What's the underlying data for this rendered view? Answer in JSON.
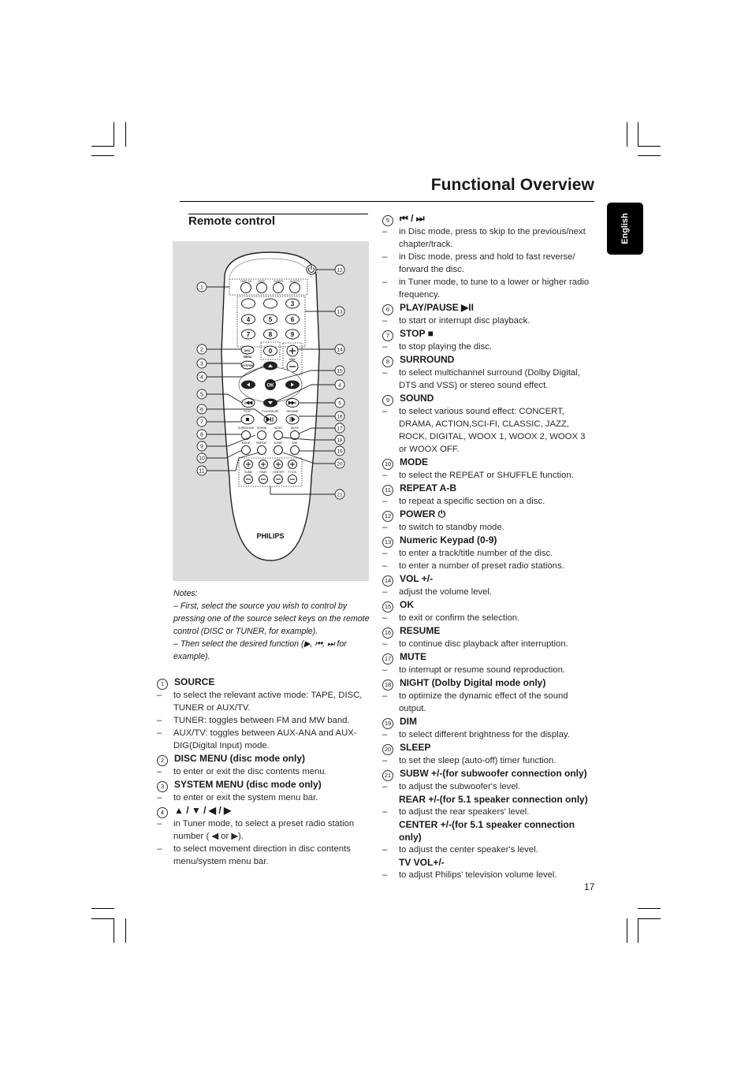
{
  "page": {
    "title": "Functional Overview",
    "section_title": "Remote control",
    "language_tab": "English",
    "page_number": "17"
  },
  "figure": {
    "remote_logo": "PHILIPS",
    "source_keys": [
      "TAPE 1/2",
      "DISC",
      "TUNER",
      "AUX/TV"
    ],
    "keypad": [
      "",
      "",
      "3",
      "4",
      "5",
      "6",
      "7",
      "8",
      "9",
      "0"
    ],
    "vol_label": "VOL",
    "disc_label": "DISC",
    "menu_label": "MENU",
    "system_label": "SYSTEM",
    "ok_label": "OK",
    "labels": {
      "stop": "STOP",
      "play_pause": "PLAY/PAUSE",
      "resume": "RESUME",
      "surround": "SURROUND",
      "sound": "SOUND",
      "night": "NIGHT",
      "mute": "MUTE",
      "mode": "MODE",
      "repeat": "REPEAT",
      "sleep": "SLEEP",
      "dim": "DIM",
      "subw": "SUBW",
      "rear": "REAR",
      "center": "CENTER",
      "tv_vol": "TV VOL"
    },
    "callouts_left": [
      "1",
      "2",
      "3",
      "4",
      "5",
      "6",
      "7",
      "8",
      "9",
      "10",
      "11"
    ],
    "callouts_right": [
      "12",
      "13",
      "14",
      "15",
      "4",
      "5",
      "16",
      "17",
      "18",
      "19",
      "20",
      "21"
    ]
  },
  "notes": {
    "heading": "Notes:",
    "lines": [
      "–  First, select the source you wish to control by pressing one of the source select keys on the remote control (DISC or TUNER, for example).",
      "–  Then select the desired function (▶, ⏮, ⏭ for example)."
    ]
  },
  "left_items": [
    {
      "num": "1",
      "title": "SOURCE",
      "desc": [
        "to select the relevant active mode: TAPE, DISC, TUNER or AUX/TV.",
        "TUNER: toggles between FM and MW band.",
        "AUX/TV: toggles between AUX-ANA and AUX-DIG(Digital Input) mode."
      ]
    },
    {
      "num": "2",
      "title": "DISC MENU (disc mode only)",
      "desc": [
        "to enter or exit the disc contents menu."
      ]
    },
    {
      "num": "3",
      "title": "SYSTEM MENU (disc mode only)",
      "desc": [
        "to enter or exit the system menu bar."
      ]
    },
    {
      "num": "4",
      "title": "▲ / ▼ / ◀ / ▶",
      "desc": [
        "in Tuner mode, to select a preset radio station number ( ◀ or ▶).",
        "to select movement direction in disc contents menu/system menu bar."
      ]
    }
  ],
  "right_items": [
    {
      "num": "5",
      "title": "⏮ / ⏭",
      "desc": [
        "in Disc mode, press to skip to the previous/next chapter/track.",
        "in Disc mode, press and hold to fast reverse/ forward the disc.",
        "in Tuner mode, to tune to a lower or higher radio frequency."
      ]
    },
    {
      "num": "6",
      "title": "PLAY/PAUSE ▶II",
      "desc": [
        "to start or interrupt disc playback."
      ]
    },
    {
      "num": "7",
      "title": "STOP ■",
      "desc": [
        "to stop playing the disc."
      ]
    },
    {
      "num": "8",
      "title": "SURROUND",
      "desc": [
        "to select multichannel surround (Dolby Digital, DTS and VSS) or stereo sound effect."
      ]
    },
    {
      "num": "9",
      "title": "SOUND",
      "desc": [
        "to select various sound effect: CONCERT, DRAMA, ACTION,SCI-FI, CLASSIC, JAZZ, ROCK, DIGITAL, WOOX 1, WOOX 2, WOOX 3 or WOOX OFF."
      ]
    },
    {
      "num": "10",
      "title": "MODE",
      "desc": [
        "to select the REPEAT or SHUFFLE function."
      ]
    },
    {
      "num": "11",
      "title": "REPEAT A-B",
      "desc": [
        "to repeat a specific section on a disc."
      ]
    },
    {
      "num": "12",
      "title": "POWER ⏻",
      "desc": [
        "to switch to standby mode."
      ]
    },
    {
      "num": "13",
      "title": "Numeric Keypad (0-9)",
      "desc": [
        "to enter a track/title number of the disc.",
        "to enter a number of preset radio stations."
      ]
    },
    {
      "num": "14",
      "title": "VOL +/-",
      "desc": [
        "adjust the volume level."
      ]
    },
    {
      "num": "15",
      "title": "OK",
      "desc": [
        "to exit or confirm the selection."
      ]
    },
    {
      "num": "16",
      "title": "RESUME",
      "desc": [
        "to continue disc playback after interruption."
      ]
    },
    {
      "num": "17",
      "title": "MUTE",
      "desc": [
        "to interrupt or resume sound reproduction."
      ]
    },
    {
      "num": "18",
      "title": "NIGHT (Dolby Digital mode only)",
      "desc": [
        "to optimize the dynamic effect of the sound output."
      ]
    },
    {
      "num": "19",
      "title": "DIM",
      "desc": [
        "to select different brightness for the display."
      ]
    },
    {
      "num": "20",
      "title": "SLEEP",
      "desc": [
        "to set the sleep (auto-off) timer function."
      ]
    },
    {
      "num": "21",
      "title": "SUBW +/-(for subwoofer connection only)",
      "desc": [
        "to adjust the subwoofer's level."
      ],
      "extra": [
        {
          "title": "REAR +/-(for 5.1 speaker connection only)",
          "desc": "to adjust the rear speakers' level."
        },
        {
          "title": "CENTER +/-(for 5.1 speaker connection only)",
          "desc": "to adjust the center speaker's level."
        },
        {
          "title": "TV VOL+/-",
          "desc": "to adjust Philips' television volume level."
        }
      ]
    }
  ]
}
